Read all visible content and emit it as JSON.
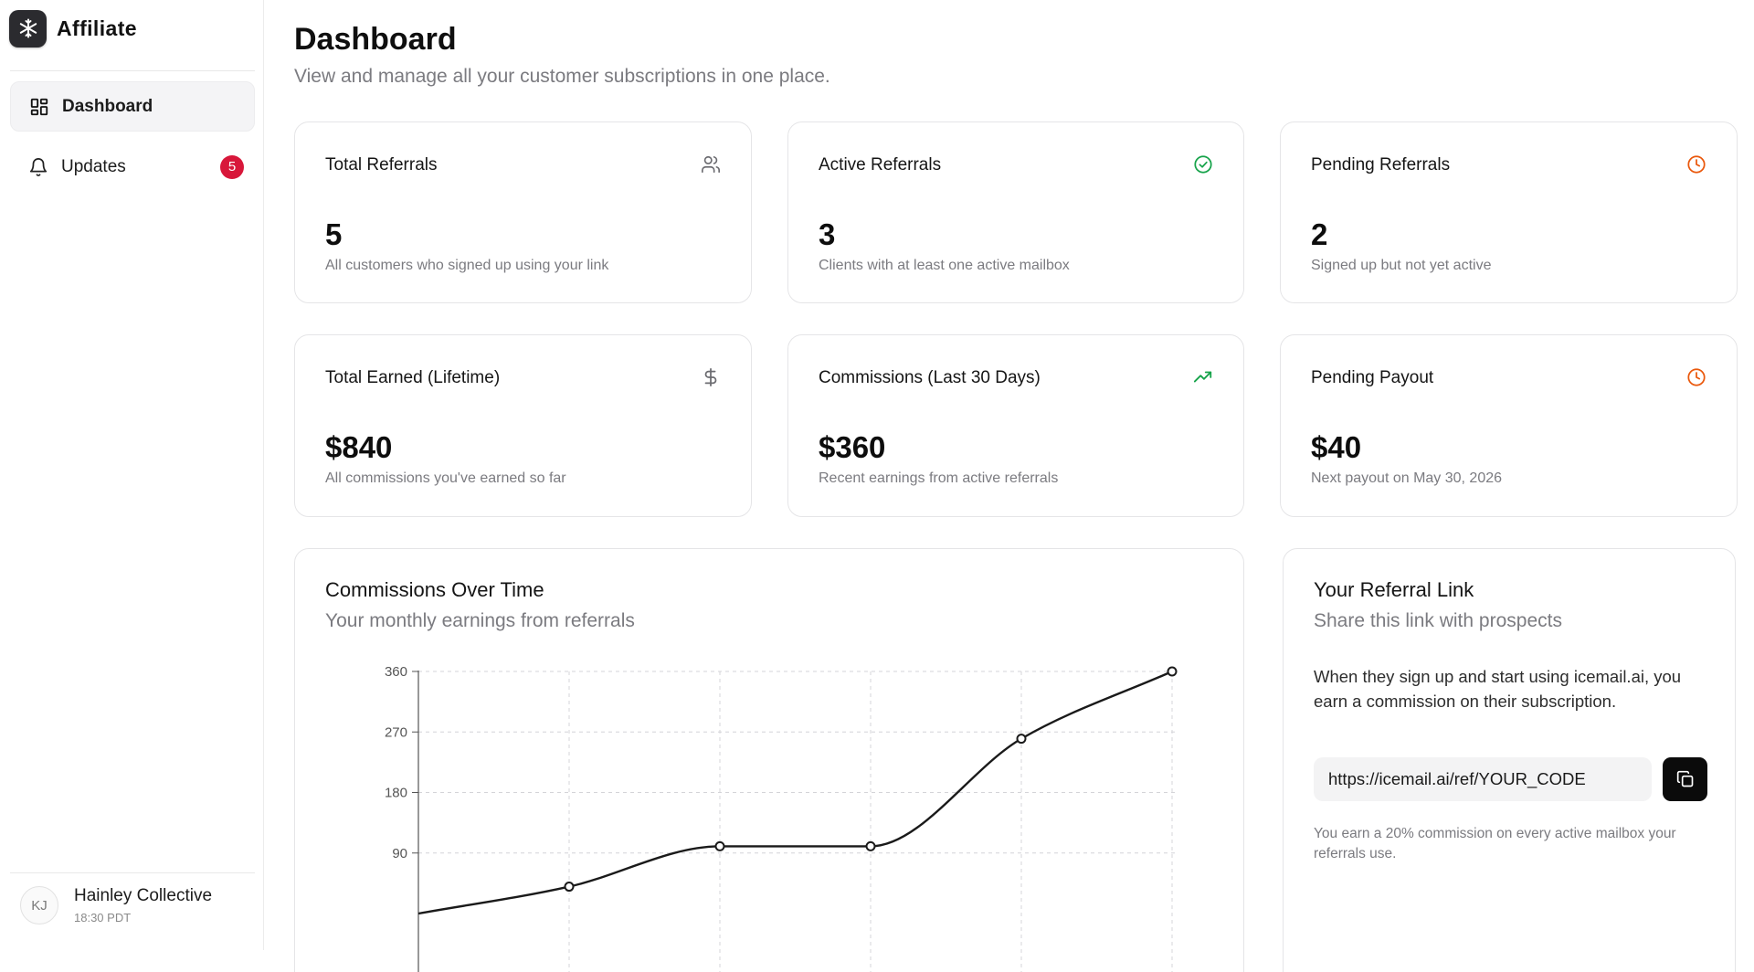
{
  "brand": {
    "name": "Affiliate",
    "logo_icon": "snowflake-icon"
  },
  "sidebar": {
    "items": [
      {
        "label": "Dashboard",
        "icon": "grid-icon",
        "active": true
      },
      {
        "label": "Updates",
        "icon": "bell-icon",
        "badge": "5"
      }
    ],
    "user": {
      "initials": "KJ",
      "name": "Hainley Collective",
      "time": "18:30 PDT"
    }
  },
  "header": {
    "title": "Dashboard",
    "subtitle": "View and manage all your customer subscriptions in one place."
  },
  "stats": [
    {
      "label": "Total Referrals",
      "value": "5",
      "desc": "All customers who signed up using your link",
      "icon": "users-icon",
      "icon_color": "#6b6b70"
    },
    {
      "label": "Active Referrals",
      "value": "3",
      "desc": "Clients with at least one active mailbox",
      "icon": "check-circle-icon",
      "icon_color": "#16a34a"
    },
    {
      "label": "Pending Referrals",
      "value": "2",
      "desc": "Signed up but not yet active",
      "icon": "clock-icon",
      "icon_color": "#ea580c"
    },
    {
      "label": "Total Earned (Lifetime)",
      "value": "$840",
      "desc": "All commissions you've earned so far",
      "icon": "dollar-icon",
      "icon_color": "#6b6b70"
    },
    {
      "label": "Commissions (Last 30 Days)",
      "value": "$360",
      "desc": "Recent earnings from active referrals",
      "icon": "trending-up-icon",
      "icon_color": "#16a34a"
    },
    {
      "label": "Pending Payout",
      "value": "$40",
      "desc": "Next payout on May 30, 2026",
      "icon": "clock-icon",
      "icon_color": "#ea580c"
    }
  ],
  "chart_card": {
    "title": "Commissions Over Time",
    "subtitle": "Your monthly earnings from referrals"
  },
  "chart_data": {
    "type": "line",
    "title": "Commissions Over Time",
    "subtitle": "Your monthly earnings from referrals",
    "xlabel": "",
    "ylabel": "",
    "yticks": [
      "360",
      "270",
      "180",
      "90"
    ],
    "ylim": [
      0,
      360
    ],
    "series": [
      {
        "values": [
          0,
          40,
          100,
          100,
          260,
          360
        ]
      }
    ],
    "grid": true,
    "curve": "smooth"
  },
  "referral": {
    "title": "Your Referral Link",
    "subtitle": "Share this link with prospects",
    "body": "When they sign up and start using icemail.ai, you earn a commission on their subscription.",
    "link": "https://icemail.ai/ref/YOUR_CODE",
    "copy_icon": "copy-icon",
    "note": "You earn a 20% commission on every active mailbox your referrals use."
  },
  "colors": {
    "accent": "#0b0b0b",
    "badge": "#d8173a",
    "green": "#16a34a",
    "orange": "#ea580c"
  }
}
